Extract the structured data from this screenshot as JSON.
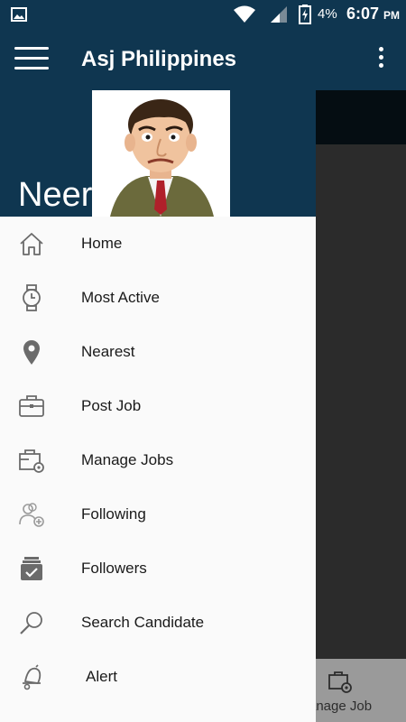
{
  "status_bar": {
    "battery": "4%",
    "time": "6:07",
    "ampm": "PM"
  },
  "app_bar": {
    "title": "Asj Philippines"
  },
  "drawer": {
    "user_name": "Neera",
    "items": [
      {
        "label": "Home",
        "icon": "home-icon"
      },
      {
        "label": "Most Active",
        "icon": "watch-icon"
      },
      {
        "label": "Nearest",
        "icon": "location-pin-icon"
      },
      {
        "label": "Post Job",
        "icon": "briefcase-icon"
      },
      {
        "label": "Manage Jobs",
        "icon": "briefcase-gear-icon"
      },
      {
        "label": "Following",
        "icon": "users-add-icon"
      },
      {
        "label": "Followers",
        "icon": "checked-box-icon"
      },
      {
        "label": "Search Candidate",
        "icon": "search-icon"
      },
      {
        "label": "Alert",
        "icon": "bell-icon"
      }
    ]
  },
  "background": {
    "bottom_tab_label": "anage Job"
  },
  "colors": {
    "primary": "#0f3650",
    "drawer_bg": "#fafafa",
    "scrim": "#2b2b2b",
    "icon_gray": "#6b6b6b"
  }
}
